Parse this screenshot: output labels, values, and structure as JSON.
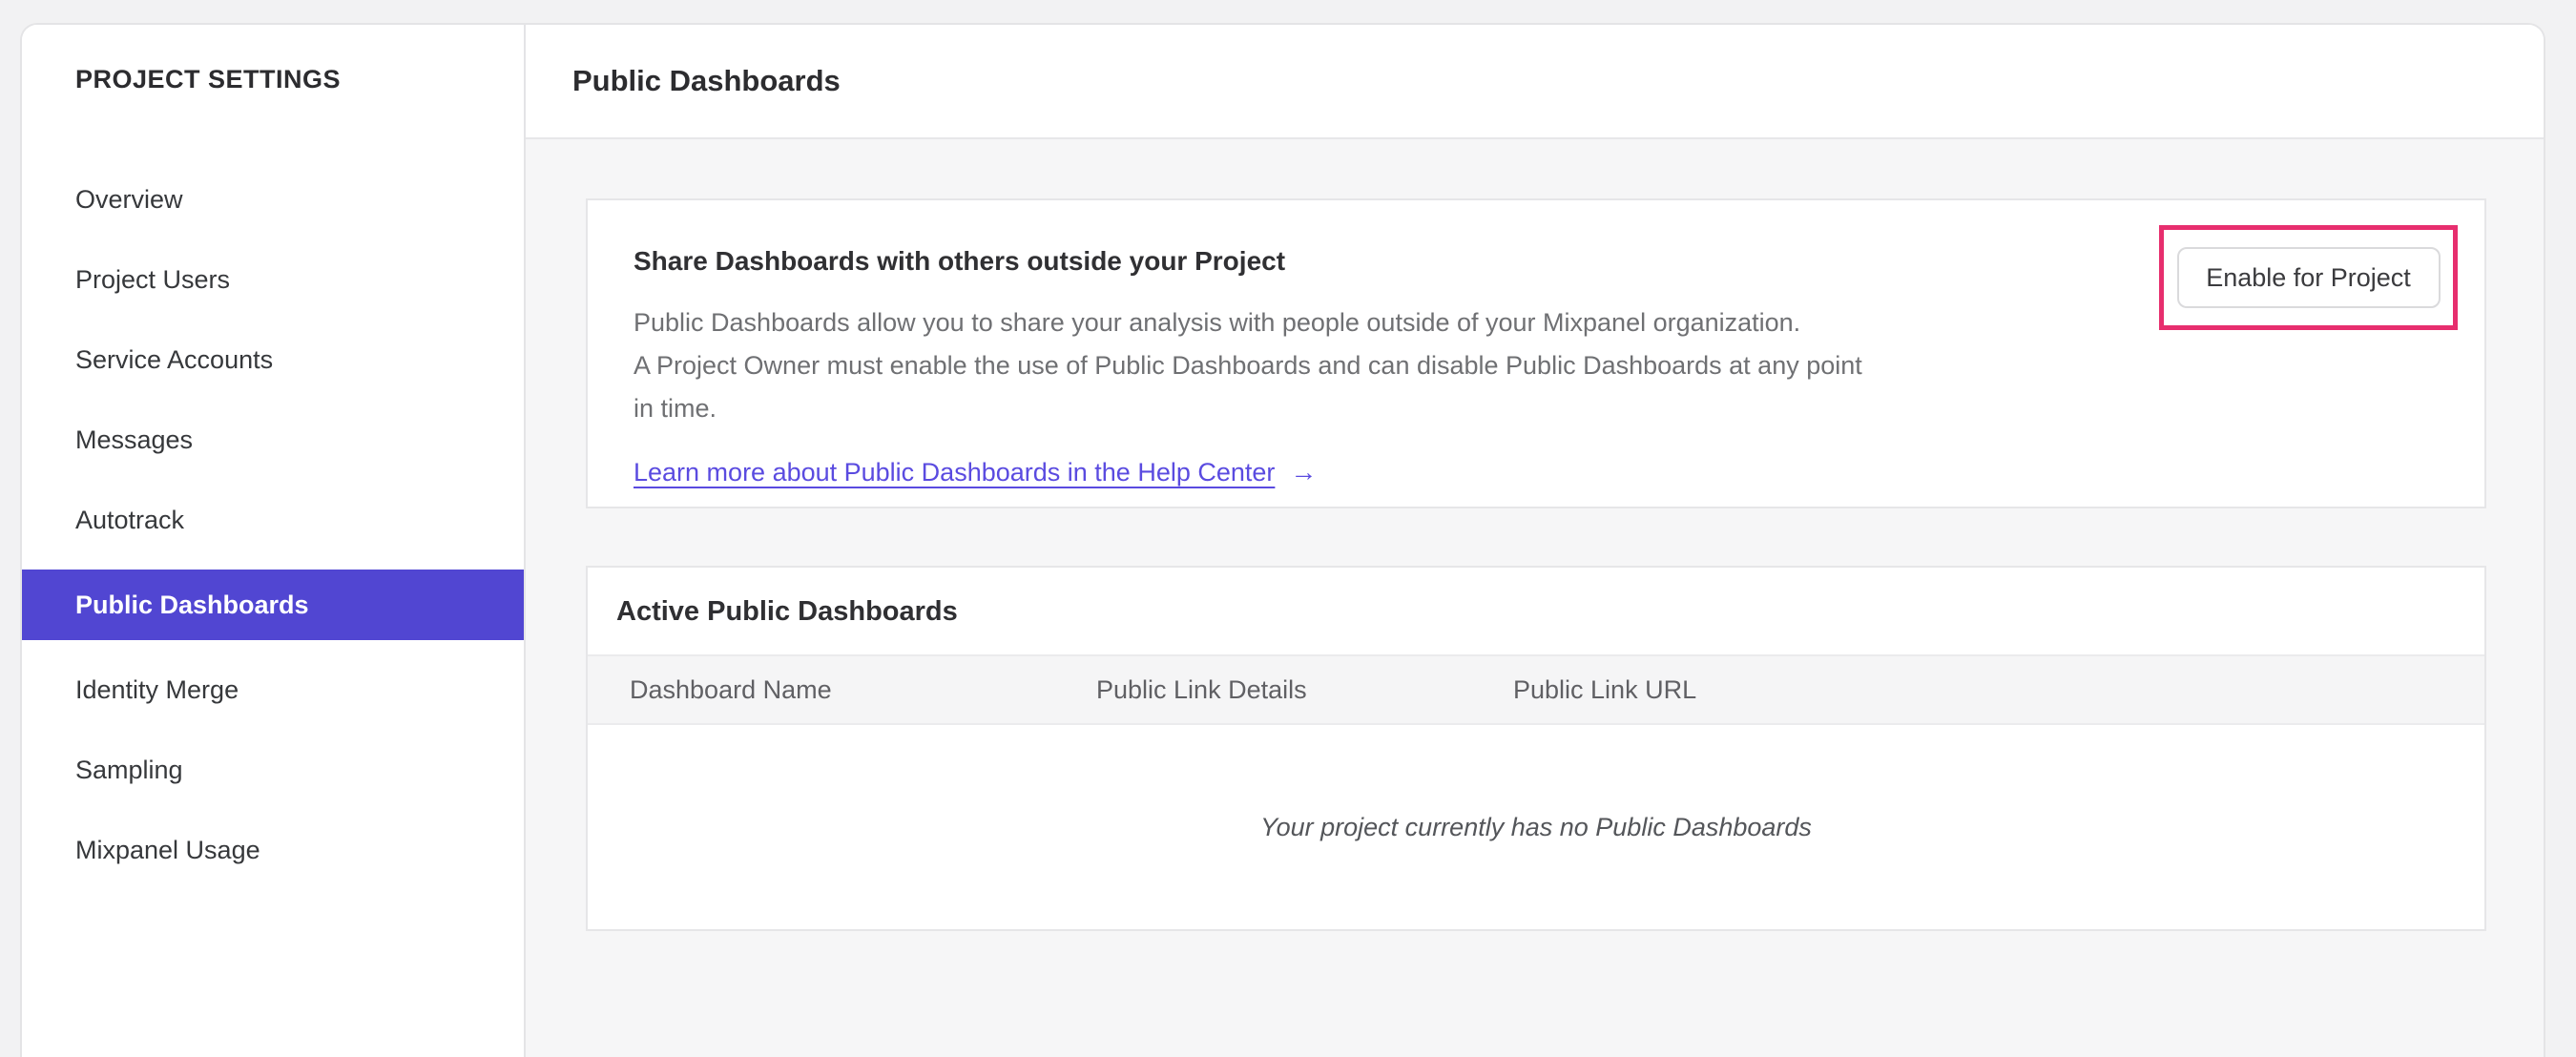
{
  "colors": {
    "accent": "#5146d2",
    "link": "#5a4be0",
    "highlight": "#e72e6e"
  },
  "sidebar": {
    "header": "PROJECT SETTINGS",
    "items": [
      {
        "label": "Overview",
        "selected": false
      },
      {
        "label": "Project Users",
        "selected": false
      },
      {
        "label": "Service Accounts",
        "selected": false
      },
      {
        "label": "Messages",
        "selected": false
      },
      {
        "label": "Autotrack",
        "selected": false
      },
      {
        "label": "Public Dashboards",
        "selected": true
      },
      {
        "label": "Identity Merge",
        "selected": false
      },
      {
        "label": "Sampling",
        "selected": false
      },
      {
        "label": "Mixpanel Usage",
        "selected": false
      }
    ]
  },
  "header": {
    "title": "Public Dashboards"
  },
  "share_card": {
    "title": "Share Dashboards with others outside your Project",
    "description_lines": [
      "Public Dashboards allow you to share your analysis with people outside of your Mixpanel organization.",
      "A Project Owner must enable the use of Public Dashboards and can disable Public Dashboards at any point",
      "in time."
    ],
    "link_label": "Learn more about Public Dashboards in the Help Center",
    "link_arrow": "→",
    "enable_button_label": "Enable for Project"
  },
  "active_card": {
    "title": "Active Public Dashboards",
    "columns": [
      "Dashboard Name",
      "Public Link Details",
      "Public Link URL"
    ],
    "empty_message": "Your project currently has no Public Dashboards"
  }
}
